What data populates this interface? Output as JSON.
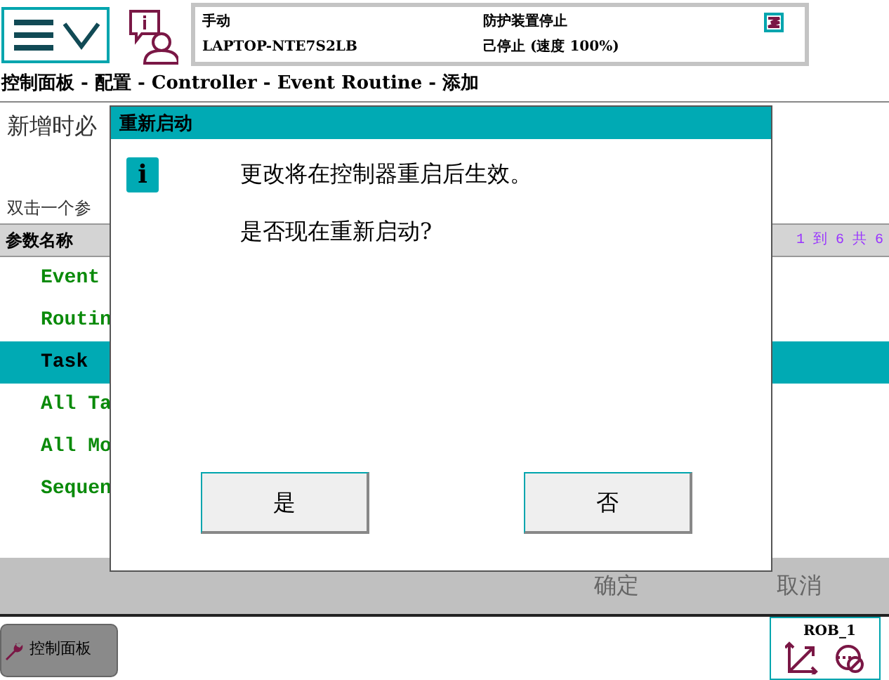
{
  "status": {
    "mode": "手动",
    "host": "LAPTOP-NTE7S2LB",
    "safety": "防护装置停止",
    "state": "己停止 (速度 100%)"
  },
  "breadcrumb": "控制面板 - 配置 - Controller - Event Routine - 添加",
  "heading": "新增时必",
  "instruction": "双击一个参",
  "table": {
    "columns": [
      "参数名称"
    ],
    "count": "1 到 6 共 6",
    "rows": [
      {
        "name": "Event",
        "selected": false
      },
      {
        "name": "Routin",
        "selected": false
      },
      {
        "name": "Task",
        "selected": true
      },
      {
        "name": "All Ta",
        "selected": false
      },
      {
        "name": "All Mo",
        "selected": false
      },
      {
        "name": "Sequen",
        "selected": false
      }
    ]
  },
  "dialog": {
    "title": "重新启动",
    "icon_text": "i",
    "messages": [
      "更改将在控制器重启后生效。",
      "是否现在重新启动?"
    ],
    "buttons": [
      "是",
      "否"
    ]
  },
  "commands": [
    "确定",
    "取消"
  ],
  "taskbar": {
    "app": "控制面板",
    "robot": "ROB_1"
  }
}
